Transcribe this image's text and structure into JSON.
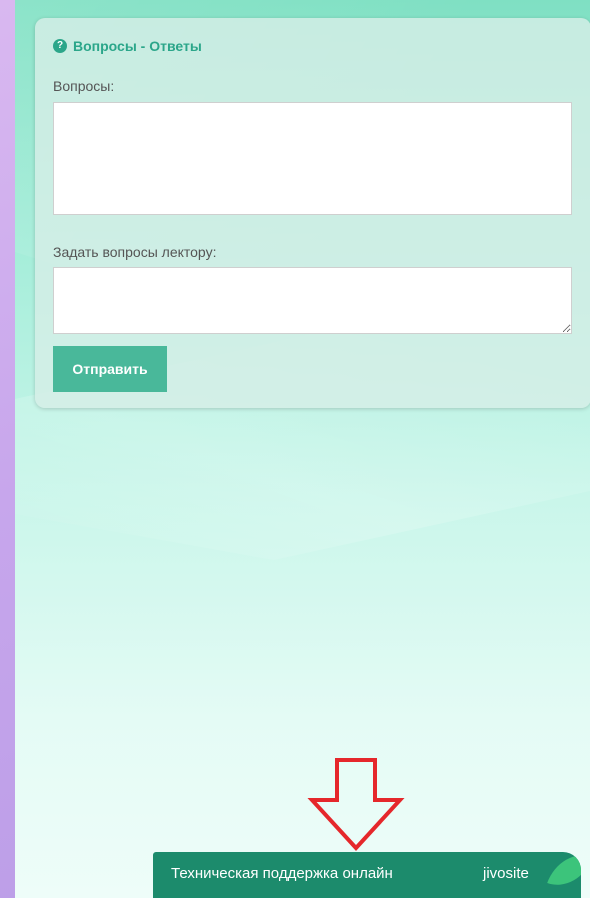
{
  "qa_panel": {
    "title": "Вопросы - Ответы",
    "help_icon_glyph": "?",
    "questions_label": "Вопросы:",
    "ask_label": "Задать вопросы лектору:",
    "ask_value": "",
    "send_label": "Отправить"
  },
  "support": {
    "text": "Техническая поддержка онлайн",
    "brand": "jivosite"
  },
  "icons": {
    "help": "question-circle-icon",
    "leaf": "leaf-icon",
    "arrow": "arrow-down-icon"
  },
  "colors": {
    "accent": "#2ba68a",
    "button": "#49b89a",
    "support_bar": "#1c8b6c",
    "arrow": "#e5272b"
  }
}
